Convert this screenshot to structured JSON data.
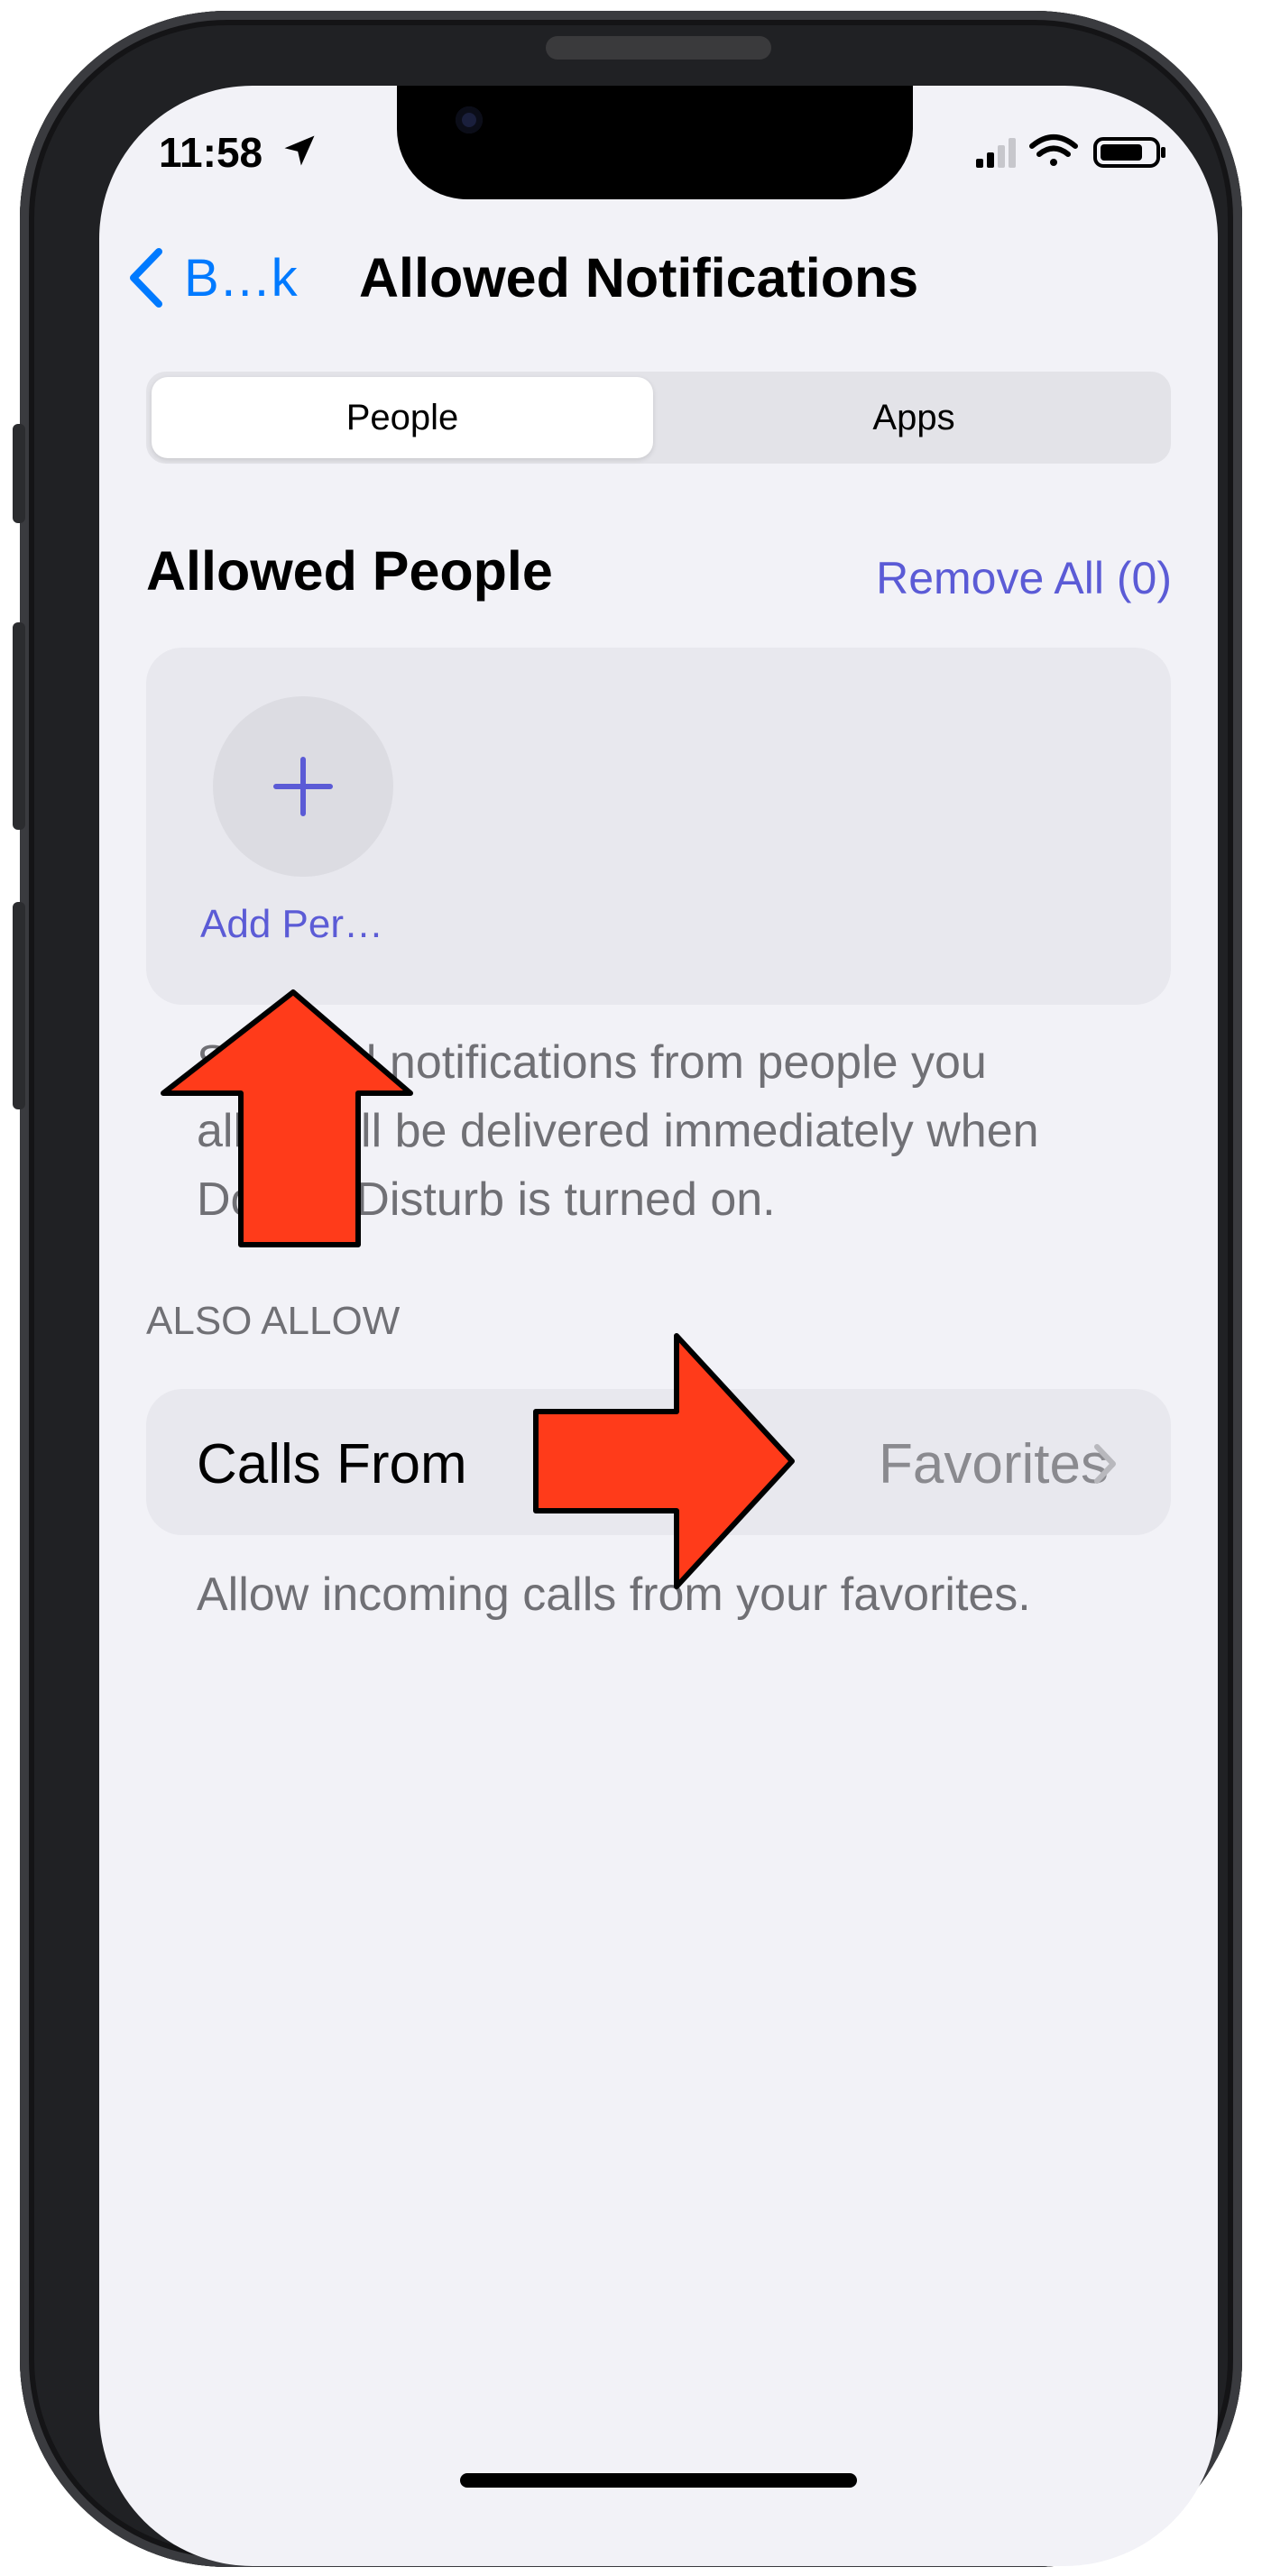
{
  "status_bar": {
    "time": "11:58",
    "location_icon": "location-arrow-icon",
    "signal_icon": "cellular-signal-icon",
    "wifi_icon": "wifi-icon",
    "battery_icon": "battery-icon"
  },
  "nav": {
    "back_label": "B…k",
    "back_icon": "chevron-left-icon",
    "title": "Allowed Notifications"
  },
  "segments": {
    "people": "People",
    "apps": "Apps",
    "selected": "People"
  },
  "allowed_people": {
    "title": "Allowed People",
    "remove_all": "Remove All (0)",
    "add_icon": "plus-icon",
    "add_label": "Add Per…",
    "footer_line1": "Silenced notifications from people you",
    "footer_line2": "allow will be delivered immediately when",
    "footer_line3": "Do Not Disturb is turned on."
  },
  "also_allow": {
    "header": "ALSO ALLOW",
    "calls_label": "Calls From",
    "calls_value": "Favorites",
    "chevron_icon": "chevron-right-icon",
    "calls_footer": "Allow incoming calls from your favorites."
  },
  "annotations": {
    "arrow_color": "#ff3b1a",
    "arrow_up_icon": "red-up-arrow-icon",
    "arrow_right_icon": "red-right-arrow-icon"
  },
  "colors": {
    "accent": "#007aff",
    "link": "#5b5bd6",
    "background": "#f2f2f7"
  }
}
